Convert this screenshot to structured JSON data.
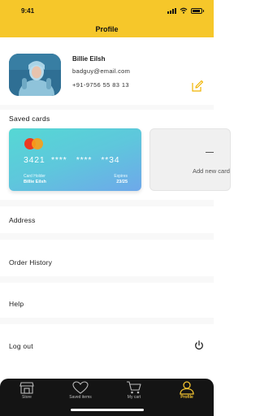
{
  "status_bar": {
    "time": "9:41"
  },
  "header": {
    "title": "Profile"
  },
  "profile": {
    "name": "Billie Eilsh",
    "email": "badguy@email.com",
    "phone": "+91-9756 55 83 13"
  },
  "saved_cards": {
    "title": "Saved cards",
    "card": {
      "number": "3421  ****   ****   **34",
      "holder_label": "Card Holder",
      "holder_name": "Billie Eilsh",
      "expires_label": "Expires",
      "expires_value": "23/25",
      "brand": "mastercard"
    },
    "add_label": "Add new card"
  },
  "menu": {
    "address": "Address",
    "order_history": "Order History",
    "help": "Help",
    "logout": "Log out"
  },
  "tabs": [
    {
      "label": "Store",
      "icon": "store-icon"
    },
    {
      "label": "Saved items",
      "icon": "heart-icon"
    },
    {
      "label": "My cart",
      "icon": "cart-icon"
    },
    {
      "label": "Profile",
      "icon": "user-icon",
      "active": true
    }
  ],
  "colors": {
    "accent": "#f6c72a",
    "tab_bar": "#141414",
    "card_start": "#55d8d4",
    "card_end": "#6ea8ea"
  }
}
